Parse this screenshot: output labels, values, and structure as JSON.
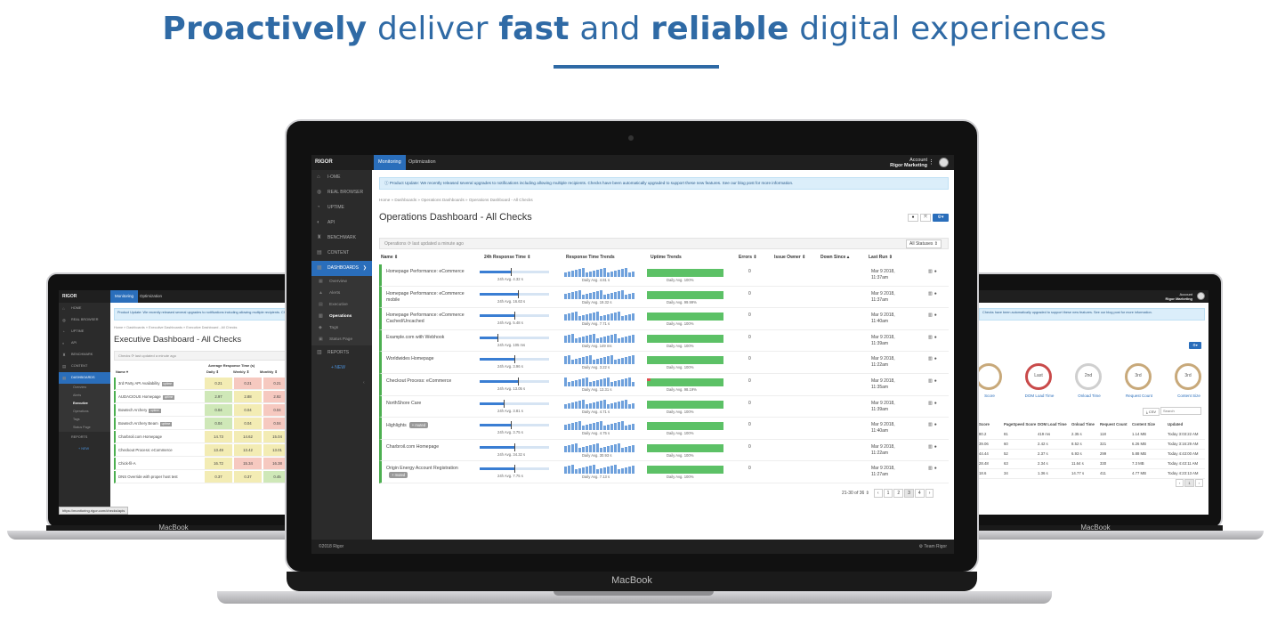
{
  "headline": {
    "w1": "Proactively",
    "w2": " deliver ",
    "w3": "fast",
    "w4": " and ",
    "w5": "reliable",
    "w6": " digital experiences"
  },
  "center": {
    "brand": "MacBook",
    "app": {
      "logo": "RIGOR",
      "tab_monitoring": "Monitoring",
      "tab_optimization": "Optimization",
      "account_label": "Account",
      "account_name": "Rigor Marketing",
      "menu_dots": "⋮",
      "notice": "Product Update: We recently released several upgrades to notifications including allowing multiple recipients. Checks have been automatically upgraded to support these new features. See our blog post for more information.",
      "breadcrumb": "Home » Dashboards » Operations Dashboards » Operations Dashboard - All Checks",
      "title": "Operations Dashboard - All Checks",
      "filter_text": "Operations  ⟳ last updated a minute ago",
      "status_select": "All Statuses ⇕",
      "columns": [
        "Name ⇕",
        "24h Response Time ⇕",
        "Response Time Trends",
        "Uptime Trends",
        "Errors ⇕",
        "Issue Owner ⇕",
        "Down Since ▴",
        "Last Run ⇕"
      ],
      "sidebar": [
        {
          "label": "I-OME",
          "icon": "⌂"
        },
        {
          "label": "REAL BROWSER",
          "icon": "◍"
        },
        {
          "label": "UPTIME",
          "icon": "◔"
        },
        {
          "label": "API",
          "icon": "◐"
        },
        {
          "label": "BENCHMARK",
          "icon": "♜"
        },
        {
          "label": "CONTENT",
          "icon": "▤"
        },
        {
          "label": "DASHBOARDS",
          "icon": "▦",
          "chevron": "❯"
        }
      ],
      "subitems": [
        {
          "label": "Overview",
          "icon": "▦"
        },
        {
          "label": "Alerts",
          "icon": "▲"
        },
        {
          "label": "Executive",
          "icon": "▤"
        },
        {
          "label": "Operations",
          "icon": "▥"
        },
        {
          "label": "Tags",
          "icon": "◆"
        },
        {
          "label": "Status Page",
          "icon": "▣"
        }
      ],
      "reports": "REPORTS",
      "new_label": "+ NEW",
      "rows": [
        {
          "name": "Homepage Performance: eCommerce",
          "tag": "",
          "avg_rt": "24h Avg. 4.32 s",
          "avg_trend": "Daily Avg. 4.81 s",
          "avg_up": "Daily Avg. 100%",
          "errors": "0",
          "last": "Mar 9 2018, 11:37am",
          "rt": 0.45,
          "bad": false
        },
        {
          "name": "Homepage Performance: eCommerce mobile",
          "tag": "",
          "avg_rt": "24h Avg. 16.63 s",
          "avg_trend": "Daily Avg. 19.32 s",
          "avg_up": "Daily Avg. 99.99%",
          "errors": "0",
          "last": "Mar 9 2018, 11:37am",
          "rt": 0.55,
          "bad": false
        },
        {
          "name": "Homepage Performance: eCommerce Cached/Uncached",
          "tag": "",
          "avg_rt": "24h Avg. 5.48 s",
          "avg_trend": "Daily Avg. 7.71 s",
          "avg_up": "Daily Avg. 100%",
          "errors": "0",
          "last": "Mar 9 2018, 11:40am",
          "rt": 0.5,
          "bad": false
        },
        {
          "name": "Example.com with Webhook",
          "tag": "",
          "avg_rt": "24h Avg. 105 ms",
          "avg_trend": "Daily Avg. 149 ms",
          "avg_up": "Daily Avg. 100%",
          "errors": "0",
          "last": "Mar 9 2018, 11:39am",
          "rt": 0.25,
          "bad": false
        },
        {
          "name": "Worldwides Homepage",
          "tag": "",
          "avg_rt": "24h Avg. 3.96 s",
          "avg_trend": "Daily Avg. 3.22 s",
          "avg_up": "Daily Avg. 100%",
          "errors": "0",
          "last": "Mar 9 2018, 11:22am",
          "rt": 0.5,
          "bad": false
        },
        {
          "name": "Checkout Process: eCommerce",
          "tag": "",
          "avg_rt": "24h Avg. 13.05 s",
          "avg_trend": "Daily Avg. 13.31 s",
          "avg_up": "Daily Avg. 98.19%",
          "errors": "0",
          "last": "Mar 9 2018, 11:35am",
          "rt": 0.55,
          "bad": true
        },
        {
          "name": "NorthShore Care",
          "tag": "",
          "avg_rt": "24h Avg. 3.81 s",
          "avg_trend": "Daily Avg. 4.71 s",
          "avg_up": "Daily Avg. 100%",
          "errors": "0",
          "last": "Mar 9 2018, 11:39am",
          "rt": 0.35,
          "bad": false
        },
        {
          "name": "Highlights",
          "tag": "+ muted",
          "avg_rt": "24h Avg. 3.75 s",
          "avg_trend": "Daily Avg. 4.75 s",
          "avg_up": "Daily Avg. 100%",
          "errors": "0",
          "last": "Mar 9 2018, 11:40am",
          "rt": 0.45,
          "bad": false
        },
        {
          "name": "Charbroil.com Homepage",
          "tag": "",
          "avg_rt": "24h Avg. 34.32 s",
          "avg_trend": "Daily Avg. 30.93 s",
          "avg_up": "Daily Avg. 100%",
          "errors": "0",
          "last": "Mar 9 2018, 11:22am",
          "rt": 0.5,
          "bad": false
        },
        {
          "name": "Origin Energy Account Registration",
          "tag": "+ muted",
          "avg_rt": "24h Avg. 7.75 s",
          "avg_trend": "Daily Avg. 7.13 s",
          "avg_up": "Daily Avg. 100%",
          "errors": "0",
          "last": "Mar 9 2018, 11:27am",
          "rt": 0.5,
          "bad": false
        }
      ],
      "pager": {
        "summary": "21-30 of 36 ⇕",
        "prev": "‹",
        "pages": [
          "1",
          "2",
          "3",
          "4"
        ],
        "current": "3",
        "next": "›"
      },
      "footer_left": "©2018 Rigor",
      "footer_right": "⚙ Team Rigor"
    }
  },
  "left": {
    "brand": "MacBook",
    "logo": "RIGOR",
    "tab_monitoring": "Monitoring",
    "tab_optimization": "Optimization",
    "notice": "Product Update: We recently released several upgrades to notifications including allowing multiple recipients. Checks have been automatically upgraded to support these new features.",
    "breadcrumb": "Home » Dashboards » Executive Dashboards » Executive Dashboard - All Checks",
    "title": "Executive Dashboard - All Checks",
    "filter_text": "Checks ⟳ last updated a minute ago",
    "group_header": "Average Response Time (s)",
    "columns": [
      "Name ▾",
      "Daily ⇕",
      "Weekly ⇕",
      "Monthly ⇕"
    ],
    "sidebar": [
      "HOME",
      "REAL BROWSER",
      "UPTIME",
      "API",
      "BENCHMARK",
      "CONTENT",
      "DASHBOARDS"
    ],
    "subitems": [
      "Overview",
      "Alerts",
      "Executive",
      "Operations",
      "Tags",
      "Status Page"
    ],
    "reports": "REPORTS",
    "new_label": "+ NEW",
    "rows": [
      {
        "name": "3rd Party API Availability",
        "tag": "uptime",
        "d": "0.21",
        "w": "0.21",
        "m": "0.21",
        "c": [
          "#f3ecb4",
          "#f6c9c0",
          "#f6c9c0"
        ]
      },
      {
        "name": "AUDACIOUS Homepage",
        "tag": "uptime",
        "d": "2.97",
        "w": "2.88",
        "m": "2.92",
        "c": [
          "#cfe8b8",
          "#f3ecb4",
          "#f6c9c0"
        ]
      },
      {
        "name": "Bowtech Archery",
        "tag": "uptime",
        "d": "0.04",
        "w": "0.04",
        "m": "0.04",
        "c": [
          "#cfe8b8",
          "#f3ecb4",
          "#f6c9c0"
        ]
      },
      {
        "name": "Bowtech Archery Beam",
        "tag": "uptime",
        "d": "0.04",
        "w": "0.04",
        "m": "0.04",
        "c": [
          "#cfe8b8",
          "#f3ecb4",
          "#f6c9c0"
        ]
      },
      {
        "name": "Charbroil.com Homepage",
        "tag": "",
        "d": "14.73",
        "w": "14.62",
        "m": "15.04",
        "c": [
          "#f3ecb4",
          "#f3ecb4",
          "#f3ecb4"
        ]
      },
      {
        "name": "Checkout Process: eCommerce",
        "tag": "",
        "d": "13.49",
        "w": "13.42",
        "m": "13.01",
        "c": [
          "#f3ecb4",
          "#f3ecb4",
          "#f3ecb4"
        ]
      },
      {
        "name": "Chick-fil-A",
        "tag": "",
        "d": "16.72",
        "w": "15.34",
        "m": "16.38",
        "c": [
          "#f3ecb4",
          "#f6c9c0",
          "#f6c9c0"
        ]
      },
      {
        "name": "DNS Override with proper host test",
        "tag": "",
        "d": "0.37",
        "w": "0.37",
        "m": "0.45",
        "c": [
          "#f3ecb4",
          "#f3ecb4",
          "#cfe8b8"
        ]
      }
    ],
    "status_url": "https://monitoring.rigor.com/checks/apis"
  },
  "right": {
    "brand": "MacBook",
    "account_label": "Account",
    "account_name": "Rigor Marketing",
    "notice": "Checks have been automatically upgraded to support these new features. See our blog post for more information.",
    "rings": [
      {
        "label": "Score",
        "value": ""
      },
      {
        "label": "DOM Load Time",
        "value": "Last"
      },
      {
        "label": "Onload Time",
        "value": "2nd"
      },
      {
        "label": "Request Count",
        "value": "3rd"
      },
      {
        "label": "Content Size",
        "value": "3rd"
      }
    ],
    "csv": "⤓ CSV",
    "search_placeholder": "Search",
    "columns": [
      "Score",
      "PageSpeed Score",
      "DOM Load Time",
      "Onload Time",
      "Request Count",
      "Content Size",
      "Updated"
    ],
    "rows": [
      [
        "80.2",
        "81",
        "419 ms",
        "2.35 s",
        "118",
        "1.14 MB",
        "Today 3:03:22 AM"
      ],
      [
        "39.06",
        "60",
        "2.42 s",
        "8.52 s",
        "321",
        "6.26 MB",
        "Today 3:16:29 AM"
      ],
      [
        "44.44",
        "52",
        "2.37 s",
        "6.93 s",
        "299",
        "5.88 MB",
        "Today 4:43:00 AM"
      ],
      [
        "28.48",
        "63",
        "2.34 s",
        "11.64 s",
        "330",
        "7.3 MB",
        "Today 4:43:11 AM"
      ],
      [
        "18.6",
        "34",
        "1.36 s",
        "14.77 s",
        "411",
        "4.77 MB",
        "Today 4:23:13 AM"
      ]
    ],
    "pager": [
      "‹",
      "1",
      "›"
    ]
  }
}
